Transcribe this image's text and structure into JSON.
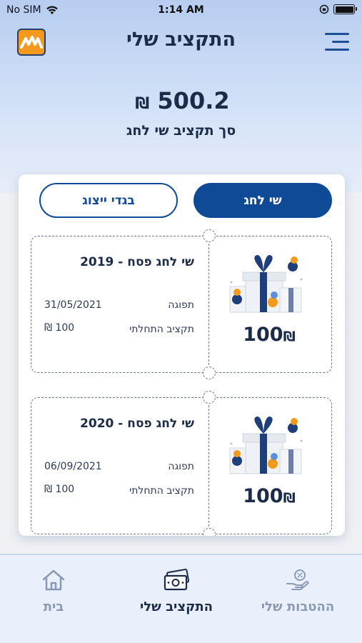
{
  "status_bar": {
    "carrier": "No SIM",
    "time": "1:14 AM"
  },
  "header": {
    "title": "התקציב שלי"
  },
  "summary": {
    "amount": "500.2",
    "currency": "₪",
    "label": "סך תקציב שי לחג"
  },
  "tabs": [
    {
      "label": "שי לחג",
      "active": true
    },
    {
      "label": "בגדי ייצוג",
      "active": false
    }
  ],
  "tickets": [
    {
      "title": "שי לחג פסח - 2019",
      "expiry_label": "תפוגה",
      "expiry_value": "31/05/2021",
      "initial_label": "תקציב התחלתי",
      "initial_value": "100",
      "initial_currency": "₪",
      "amount": "100",
      "currency": "₪"
    },
    {
      "title": "שי לחג פסח - 2020",
      "expiry_label": "תפוגה",
      "expiry_value": "06/09/2021",
      "initial_label": "תקציב התחלתי",
      "initial_value": "100",
      "initial_currency": "₪",
      "amount": "100",
      "currency": "₪"
    }
  ],
  "bottom_nav": [
    {
      "label": "בית",
      "icon": "home-icon"
    },
    {
      "label": "התקציב שלי",
      "icon": "money-icon",
      "active": true
    },
    {
      "label": "ההטבות שלי",
      "icon": "benefits-icon"
    }
  ],
  "colors": {
    "primary": "#0f4a97",
    "accent": "#f39a1d",
    "text": "#1c2b47"
  }
}
